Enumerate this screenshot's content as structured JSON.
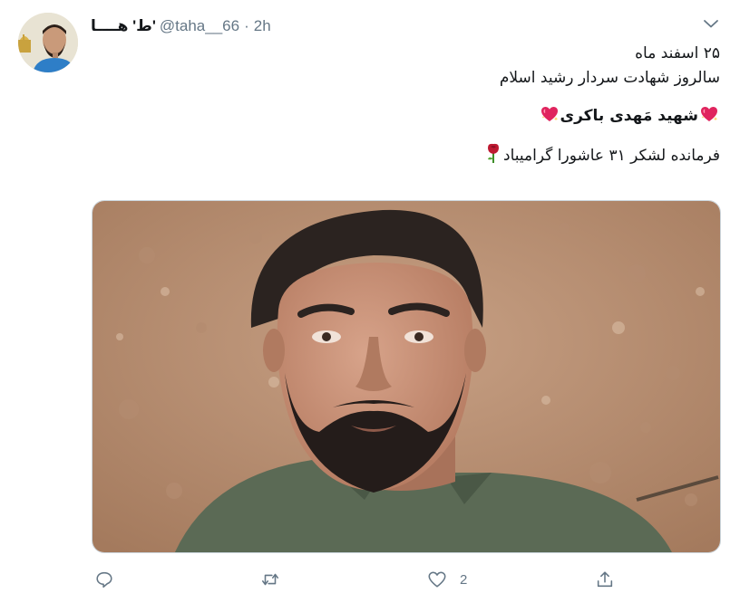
{
  "tweet": {
    "author": {
      "display_name": "ط' هــــا'",
      "handle": "@taha__66",
      "separator": "·",
      "time": "2h"
    },
    "lines": [
      "۲۵ اسفند ماه",
      "سالروز شهادت سردار رشید اسلام",
      "شهید مَهدی باکری",
      "فرمانده لشکر ۳۱ عاشورا گرامیباد"
    ],
    "icons": {
      "caret": "chevron-down-icon",
      "reply": "reply-icon",
      "retweet": "retweet-icon",
      "like": "heart-icon",
      "share": "share-icon",
      "emoji_heart": "sparkling-heart-icon",
      "emoji_rose": "rose-icon"
    },
    "actions": {
      "like_count": "2"
    }
  },
  "colors": {
    "text": "#14171a",
    "secondary": "#657786",
    "border": "#ccd6dd",
    "heart_emoji": "#e0245e",
    "rose": "#be1931"
  }
}
